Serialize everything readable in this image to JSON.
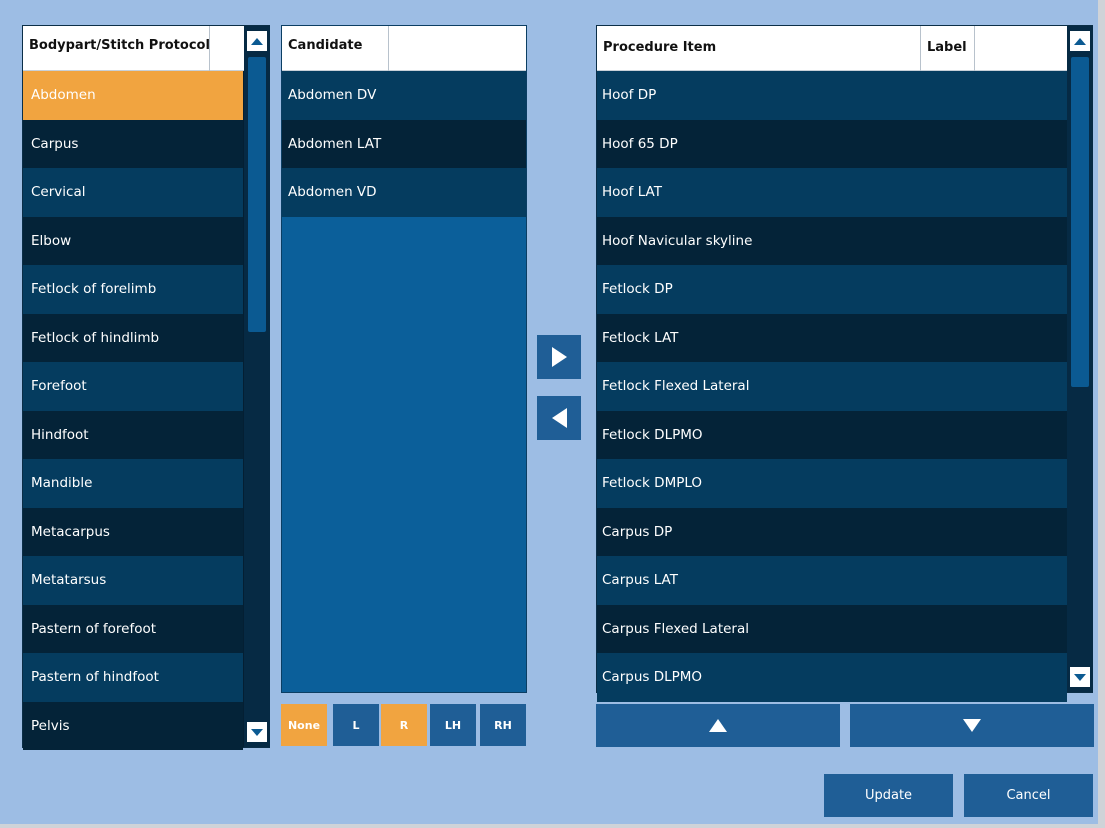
{
  "bodypart_list": {
    "header": "Bodypart/Stitch Protocol",
    "items": [
      {
        "label": "Abdomen",
        "selected": true
      },
      {
        "label": "Carpus"
      },
      {
        "label": "Cervical"
      },
      {
        "label": "Elbow"
      },
      {
        "label": "Fetlock of forelimb"
      },
      {
        "label": "Fetlock of hindlimb"
      },
      {
        "label": "Forefoot"
      },
      {
        "label": "Hindfoot"
      },
      {
        "label": "Mandible"
      },
      {
        "label": "Metacarpus"
      },
      {
        "label": "Metatarsus"
      },
      {
        "label": "Pastern of forefoot"
      },
      {
        "label": "Pastern of hindfoot"
      },
      {
        "label": "Pelvis"
      }
    ]
  },
  "candidate_list": {
    "header": "Candidate",
    "items": [
      "Abdomen DV",
      "Abdomen LAT",
      "Abdomen VD"
    ]
  },
  "laterality_options": [
    {
      "label": "None",
      "active": true
    },
    {
      "label": "L",
      "active": false
    },
    {
      "label": "R",
      "active": true
    },
    {
      "label": "LH",
      "active": false
    },
    {
      "label": "RH",
      "active": false
    }
  ],
  "procedure_list": {
    "header": "Procedure Item",
    "label_header": "Label",
    "items": [
      "Hoof DP",
      "Hoof 65 DP",
      "Hoof LAT",
      "Hoof Navicular skyline",
      "Fetlock DP",
      "Fetlock LAT",
      "Fetlock Flexed Lateral",
      "Fetlock DLPMO",
      "Fetlock DMPLO",
      "Carpus DP",
      "Carpus LAT",
      "Carpus Flexed Lateral",
      "Carpus DLPMO"
    ]
  },
  "actions": {
    "update": "Update",
    "cancel": "Cancel"
  },
  "colors": {
    "background": "#9dbde4",
    "selected": "#f1a440",
    "button": "#1f5e96"
  }
}
